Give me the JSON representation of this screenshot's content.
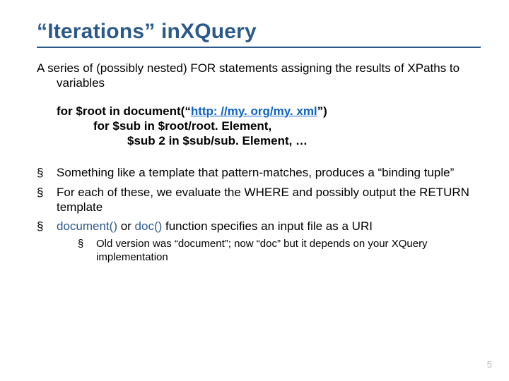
{
  "title_part1": "“Iterations” in",
  "title_part2": "XQuery",
  "intro": "A series of (possibly nested) FOR statements assigning the results of XPaths to variables",
  "code": {
    "line1_pre": "for $root in document(“",
    "line1_link": "http: //my. org/my. xml",
    "line1_post": "”)",
    "line2": "for $sub in $root/root. Element,",
    "line3": "$sub 2 in $sub/sub. Element, …"
  },
  "bullets": [
    "Something like a template that pattern-matches, produces a “binding tuple”",
    "For each of these, we evaluate the WHERE and possibly output the RETURN template"
  ],
  "bullet3_pre": "",
  "bullet3_fn1": "document()",
  "bullet3_mid": " or ",
  "bullet3_fn2": "doc()",
  "bullet3_post": " function specifies an input file as a URI",
  "sub_bullet": "Old version was “document”; now “doc” but it depends on your XQuery implementation",
  "page_number": "5"
}
